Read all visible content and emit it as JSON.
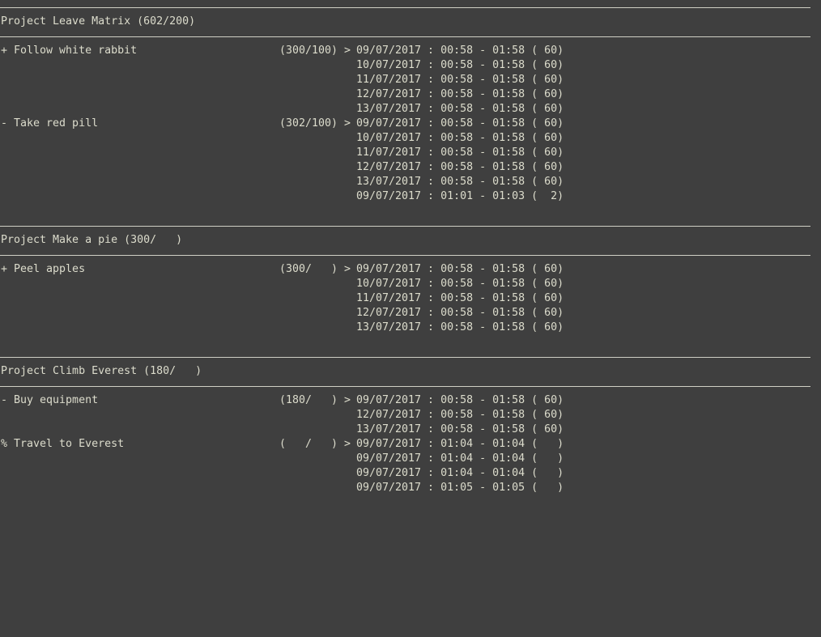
{
  "projects": [
    {
      "header": "Project Leave Matrix (602/200)",
      "tasks": [
        {
          "label": "+ Follow white rabbit",
          "totals": "(300/100)",
          "arrow": ">",
          "entries": [
            "09/07/2017 : 00:58 - 01:58 ( 60)",
            "10/07/2017 : 00:58 - 01:58 ( 60)",
            "11/07/2017 : 00:58 - 01:58 ( 60)",
            "12/07/2017 : 00:58 - 01:58 ( 60)",
            "13/07/2017 : 00:58 - 01:58 ( 60)"
          ]
        },
        {
          "label": "- Take red pill",
          "totals": "(302/100)",
          "arrow": ">",
          "entries": [
            "09/07/2017 : 00:58 - 01:58 ( 60)",
            "10/07/2017 : 00:58 - 01:58 ( 60)",
            "11/07/2017 : 00:58 - 01:58 ( 60)",
            "12/07/2017 : 00:58 - 01:58 ( 60)",
            "13/07/2017 : 00:58 - 01:58 ( 60)",
            "09/07/2017 : 01:01 - 01:03 (  2)"
          ]
        }
      ]
    },
    {
      "header": "Project Make a pie (300/   )",
      "tasks": [
        {
          "label": "+ Peel apples",
          "totals": "(300/   )",
          "arrow": ">",
          "entries": [
            "09/07/2017 : 00:58 - 01:58 ( 60)",
            "10/07/2017 : 00:58 - 01:58 ( 60)",
            "11/07/2017 : 00:58 - 01:58 ( 60)",
            "12/07/2017 : 00:58 - 01:58 ( 60)",
            "13/07/2017 : 00:58 - 01:58 ( 60)"
          ]
        }
      ]
    },
    {
      "header": "Project Climb Everest (180/   )",
      "tasks": [
        {
          "label": "- Buy equipment",
          "totals": "(180/   )",
          "arrow": ">",
          "entries": [
            "09/07/2017 : 00:58 - 01:58 ( 60)",
            "12/07/2017 : 00:58 - 01:58 ( 60)",
            "13/07/2017 : 00:58 - 01:58 ( 60)"
          ]
        },
        {
          "label": "% Travel to Everest",
          "totals": "(   /   )",
          "arrow": ">",
          "entries": [
            "09/07/2017 : 01:04 - 01:04 (   )",
            "09/07/2017 : 01:04 - 01:04 (   )",
            "09/07/2017 : 01:04 - 01:04 (   )",
            "09/07/2017 : 01:05 - 01:05 (   )"
          ]
        }
      ]
    }
  ]
}
